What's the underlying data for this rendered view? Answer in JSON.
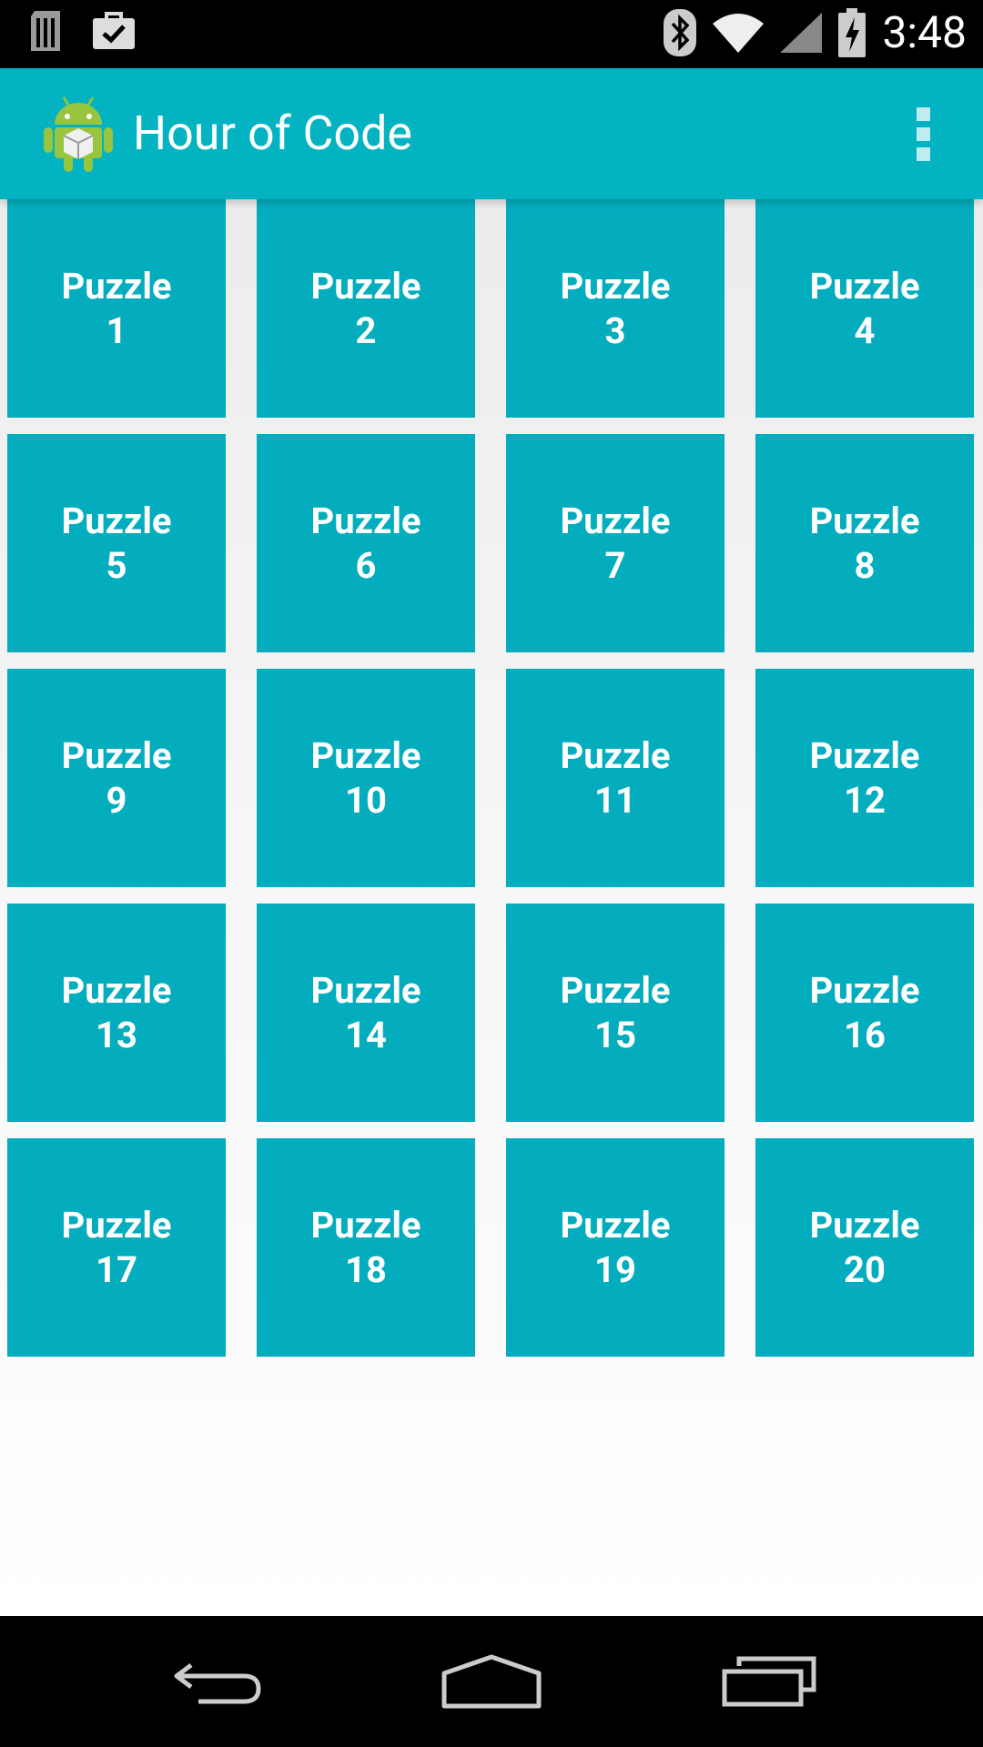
{
  "status_bar": {
    "time": "3:48",
    "icons": [
      "sim-card-icon",
      "briefcase-check-icon",
      "bluetooth-icon",
      "wifi-icon",
      "signal-icon",
      "battery-charging-icon"
    ]
  },
  "action_bar": {
    "title": "Hour of Code",
    "app_icon": "android-cube-icon",
    "overflow_icon": "overflow-menu-icon"
  },
  "tiles": [
    {
      "label": "Puzzle",
      "number": "1"
    },
    {
      "label": "Puzzle",
      "number": "2"
    },
    {
      "label": "Puzzle",
      "number": "3"
    },
    {
      "label": "Puzzle",
      "number": "4"
    },
    {
      "label": "Puzzle",
      "number": "5"
    },
    {
      "label": "Puzzle",
      "number": "6"
    },
    {
      "label": "Puzzle",
      "number": "7"
    },
    {
      "label": "Puzzle",
      "number": "8"
    },
    {
      "label": "Puzzle",
      "number": "9"
    },
    {
      "label": "Puzzle",
      "number": "10"
    },
    {
      "label": "Puzzle",
      "number": "11"
    },
    {
      "label": "Puzzle",
      "number": "12"
    },
    {
      "label": "Puzzle",
      "number": "13"
    },
    {
      "label": "Puzzle",
      "number": "14"
    },
    {
      "label": "Puzzle",
      "number": "15"
    },
    {
      "label": "Puzzle",
      "number": "16"
    },
    {
      "label": "Puzzle",
      "number": "17"
    },
    {
      "label": "Puzzle",
      "number": "18"
    },
    {
      "label": "Puzzle",
      "number": "19"
    },
    {
      "label": "Puzzle",
      "number": "20"
    }
  ],
  "nav_bar": {
    "icons": [
      "back-icon",
      "home-icon",
      "recent-apps-icon"
    ]
  },
  "colors": {
    "action_bar": "#03b3c2",
    "tile": "#03adbe",
    "tile_text": "#ffffff",
    "background": "#f2f2f2"
  }
}
